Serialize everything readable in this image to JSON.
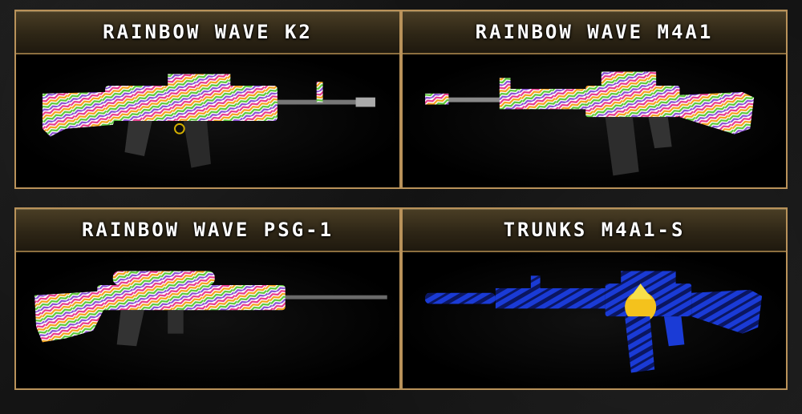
{
  "cards": [
    {
      "title": "RAINBOW WAVE K2",
      "skin": "rainbow"
    },
    {
      "title": "RAINBOW WAVE M4A1",
      "skin": "rainbow"
    },
    {
      "title": "RAINBOW WAVE PSG-1",
      "skin": "rainbow"
    },
    {
      "title": "TRUNKS M4A1-S",
      "skin": "blue"
    }
  ],
  "colors": {
    "frame_border": "#b9925a",
    "header_top": "#4a3e25",
    "header_bottom": "#1f190e",
    "title_text": "#ffffff",
    "blue_skin": "#1a3bd6"
  }
}
